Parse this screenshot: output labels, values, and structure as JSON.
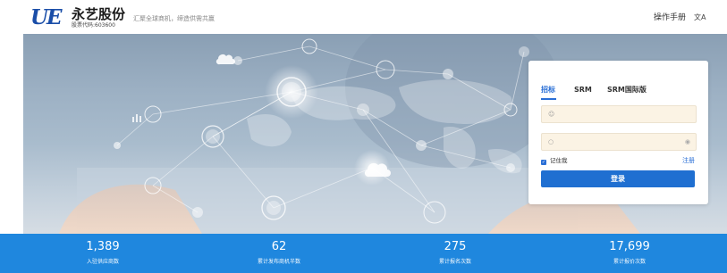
{
  "header": {
    "logo_mark": "UE",
    "company_name": "永艺股份",
    "stock_code": "股票代码:603600",
    "slogan": "汇聚全球商机，缔造供需共赢",
    "manual_label": "操作手册",
    "lang_icon": "translate-icon"
  },
  "login": {
    "tabs": [
      {
        "label": "招标",
        "active": true
      },
      {
        "label": "SRM",
        "active": false
      },
      {
        "label": "SRM国际版",
        "active": false
      }
    ],
    "username_icon": "user-icon",
    "username_placeholder": "",
    "password_icon": "lock-icon",
    "password_placeholder": "",
    "remember_label": "记住我",
    "remember_checked": true,
    "register_label": "注册",
    "login_button": "登录",
    "accent_color": "#1f6fd1"
  },
  "stats": [
    {
      "value": "1,389",
      "label": "入驻供应商数"
    },
    {
      "value": "62",
      "label": "累计发布商机半数"
    },
    {
      "value": "275",
      "label": "累计报名次数"
    },
    {
      "value": "17,699",
      "label": "累计报价次数"
    }
  ],
  "colors": {
    "stats_bar": "#1f87de",
    "brand": "#1a4ea8"
  }
}
